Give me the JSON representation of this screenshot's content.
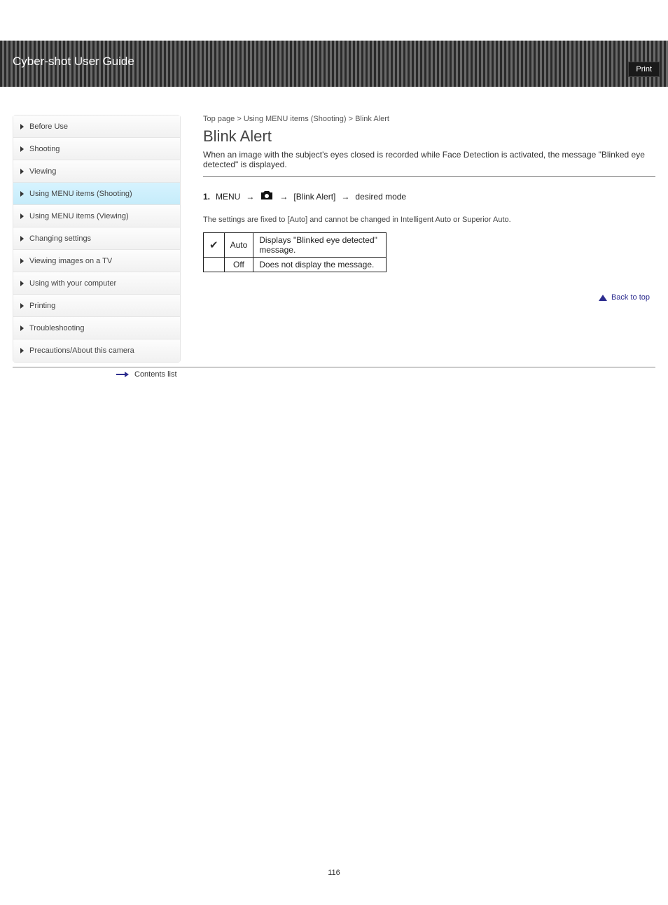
{
  "header": {
    "title": "Cyber-shot User Guide",
    "top_link": "Print"
  },
  "sidebar": {
    "items": [
      "Before Use",
      "Shooting",
      "Viewing",
      "Using MENU items (Shooting)",
      "Using MENU items (Viewing)",
      "Changing settings",
      "Viewing images on a TV",
      "Using with your computer",
      "Printing",
      "Troubleshooting",
      "Precautions/About this camera"
    ],
    "active_index": 3
  },
  "breadcrumb": [
    "Top page",
    "Using MENU items (Shooting)",
    "Blink Alert"
  ],
  "page": {
    "title": "Blink Alert",
    "intro": "When an image with the subject's eyes closed is recorded while Face Detection is activated, the message \"Blinked eye detected\" is displayed.",
    "flow_steps": [
      "MENU",
      "",
      "[Blink Alert]",
      "desired mode"
    ],
    "note": "The settings are fixed to [Auto] and cannot be changed in Intelligent Auto or Superior Auto.",
    "options": [
      {
        "checked": true,
        "label": "Auto",
        "desc": "Displays \"Blinked eye detected\" message."
      },
      {
        "checked": false,
        "label": "Off",
        "desc": "Does not display the message."
      }
    ],
    "back_to_top": "Back to top"
  },
  "footer": {
    "contents_link": "Contents list",
    "page_number": "116"
  }
}
